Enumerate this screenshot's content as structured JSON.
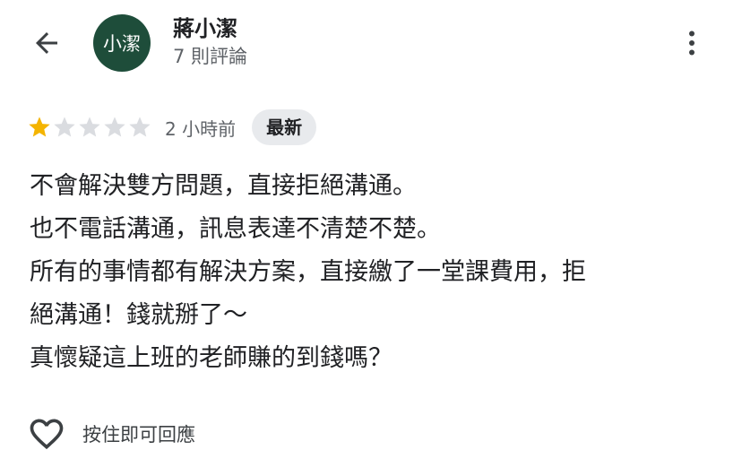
{
  "header": {
    "back_icon": "arrow-left-icon",
    "avatar_text": "小潔",
    "avatar_color": "#1e4d3a",
    "user_name": "蔣小潔",
    "review_count": "7 則評論",
    "more_icon": "more-vertical-icon"
  },
  "review": {
    "rating": 1,
    "max_rating": 5,
    "star_color_filled": "#f4b400",
    "star_color_empty": "#dadce0",
    "time": "2 小時前",
    "badge": "最新",
    "lines": [
      "不會解決雙方問題，直接拒絕溝通。",
      "也不電話溝通，訊息表達不清楚不楚。",
      "所有的事情都有解決方案，直接繳了一堂課費用，拒",
      "絕溝通！錢就掰了～",
      "真懷疑這上班的老師賺的到錢嗎？"
    ]
  },
  "reply": {
    "icon": "heart-outline-icon",
    "label": "按住即可回應"
  }
}
